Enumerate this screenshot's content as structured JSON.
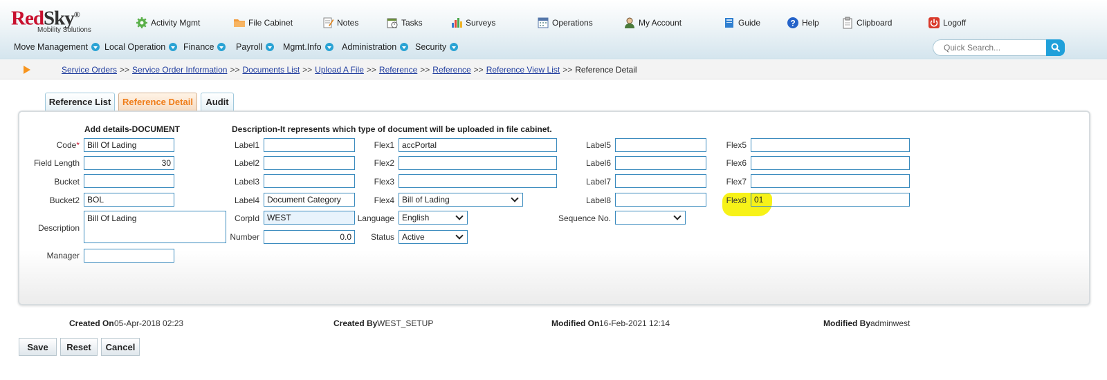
{
  "logo": {
    "brand_red": "Red",
    "brand_dark": "Sky",
    "reg": "®",
    "tagline": "Mobility Solutions"
  },
  "topnav": [
    {
      "label": "Activity Mgmt",
      "icon": "gear-icon"
    },
    {
      "label": "File Cabinet",
      "icon": "folder-icon"
    },
    {
      "label": "Notes",
      "icon": "notes-icon"
    },
    {
      "label": "Tasks",
      "icon": "tasks-icon"
    },
    {
      "label": "Surveys",
      "icon": "bar-chart-icon"
    },
    {
      "label": "Operations",
      "icon": "calendar-icon"
    },
    {
      "label": "My Account",
      "icon": "user-icon"
    },
    {
      "label": "Guide",
      "icon": "book-icon"
    },
    {
      "label": "Help",
      "icon": "help-icon"
    },
    {
      "label": "Clipboard",
      "icon": "clipboard-icon"
    },
    {
      "label": "Logoff",
      "icon": "power-icon"
    }
  ],
  "mainnav": [
    "Move Management",
    "Local Operation",
    "Finance",
    "Payroll",
    "Mgmt.Info",
    "Administration",
    "Security"
  ],
  "search": {
    "placeholder": "Quick Search..."
  },
  "breadcrumb": {
    "links": [
      "Service Orders",
      "Service Order Information",
      "Documents List",
      "Upload A File",
      "Reference",
      "Reference",
      "Reference View List"
    ],
    "separator": ">>",
    "current": "Reference Detail"
  },
  "tabs": [
    "Reference List",
    "Reference Detail",
    "Audit"
  ],
  "form": {
    "add_details_header": "Add details-DOCUMENT",
    "description_header": "Description-It represents which type of document will be uploaded in file cabinet.",
    "code_label": "Code",
    "code_required_mark": "*",
    "code_value": "Bill Of Lading",
    "field_length_label": "Field Length",
    "field_length_value": "30",
    "bucket_label": "Bucket",
    "bucket_value": "",
    "bucket2_label": "Bucket2",
    "bucket2_value": "BOL",
    "description_label": "Description",
    "description_value": "Bill Of Lading",
    "manager_label": "Manager",
    "manager_value": "",
    "label1_label": "Label1",
    "label1_value": "",
    "label2_label": "Label2",
    "label2_value": "",
    "label3_label": "Label3",
    "label3_value": "",
    "label4_label": "Label4",
    "label4_value": "Document Category",
    "corpid_label": "CorpId",
    "corpid_value": "WEST",
    "number_label": "Number",
    "number_value": "0.0",
    "flex1_label": "Flex1",
    "flex1_value": "accPortal",
    "flex2_label": "Flex2",
    "flex2_value": "",
    "flex3_label": "Flex3",
    "flex3_value": "",
    "flex4_label": "Flex4",
    "flex4_value": "Bill of Lading",
    "language_label": "Language",
    "language_value": "English",
    "status_label": "Status",
    "status_value": "Active",
    "label5_label": "Label5",
    "label5_value": "",
    "label6_label": "Label6",
    "label6_value": "",
    "label7_label": "Label7",
    "label7_value": "",
    "label8_label": "Label8",
    "label8_value": "",
    "sequence_label": "Sequence No.",
    "sequence_value": "",
    "flex5_label": "Flex5",
    "flex5_value": "",
    "flex6_label": "Flex6",
    "flex6_value": "",
    "flex7_label": "Flex7",
    "flex7_value": "",
    "flex8_label": "Flex8",
    "flex8_value": "01"
  },
  "meta": {
    "created_on_label": "Created On",
    "created_on_value": "05-Apr-2018 02:23",
    "created_by_label": "Created By",
    "created_by_value": "WEST_SETUP",
    "modified_on_label": "Modified On",
    "modified_on_value": "16-Feb-2021 12:14",
    "modified_by_label": "Modified By",
    "modified_by_value": "adminwest"
  },
  "buttons": {
    "save": "Save",
    "reset": "Reset",
    "cancel": "Cancel"
  },
  "colors": {
    "accent": "#1fa0da",
    "active_tab": "#ef7d1a",
    "brand_red": "#c8102e",
    "highlight": "#f7f10c",
    "link": "#1f3c9e"
  }
}
